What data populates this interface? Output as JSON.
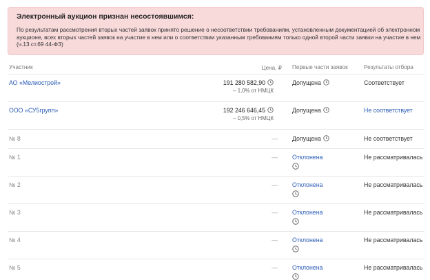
{
  "alert": {
    "title": "Электронный аукцион признан несостоявшимся:",
    "text": "По результатам рассмотрения вторых частей заявок принято решение о несоответствии требованиям, установленным документацией об электронном аукционе, всех вторых частей заявок на участие в нем или о соответствии указанным требованиям только одной второй части заявки на участие в нем (ч.13 ст.69 44-ФЗ)"
  },
  "table": {
    "headers": {
      "participant": "Участник",
      "price": "Цена, ₽",
      "first_parts": "Первые части заявок",
      "results": "Результаты отбора"
    },
    "rows": [
      {
        "participant": "АО «Мелиострой»",
        "price": "191 280 582,90",
        "price_sub": "– 1,0% от НМЦК",
        "first_part": "Допущена",
        "result": "Соответствует"
      },
      {
        "participant": "ООО «СУ5групп»",
        "price": "192 246 646,45",
        "price_sub": "– 0,5% от НМЦК",
        "first_part": "Допущена",
        "result": "Не соответствует"
      },
      {
        "participant": "№ 8",
        "price": "—",
        "first_part": "Допущена",
        "result": "Не соответствует"
      },
      {
        "participant": "№ 1",
        "price": "—",
        "first_part": "Отклонена",
        "result": "Не рассматривалась"
      },
      {
        "participant": "№ 2",
        "price": "—",
        "first_part": "Отклонена",
        "result": "Не рассматривалась"
      },
      {
        "participant": "№ 3",
        "price": "—",
        "first_part": "Отклонена",
        "result": "Не рассматривалась"
      },
      {
        "participant": "№ 4",
        "price": "—",
        "first_part": "Отклонена",
        "result": "Не рассматривалась"
      },
      {
        "participant": "№ 5",
        "price": "—",
        "first_part": "Отклонена",
        "result": "Не рассматривалась"
      }
    ]
  },
  "icons": {
    "clock": "clock-icon"
  },
  "colors": {
    "alert_bg": "#f9dadb",
    "link": "#2a5bb5"
  }
}
